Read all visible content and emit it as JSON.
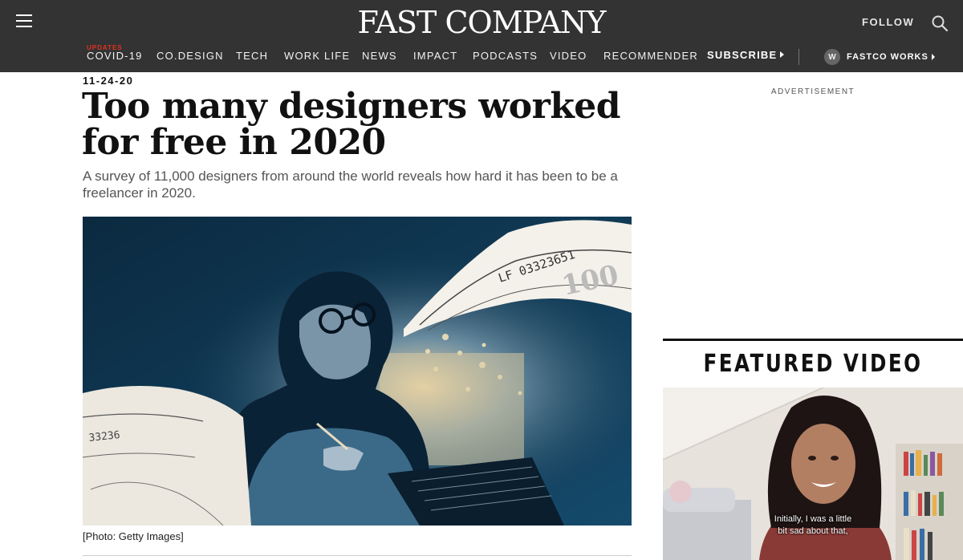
{
  "header": {
    "logo": "FAST COMPANY",
    "follow_label": "FOLLOW",
    "updates_label": "UPDATES",
    "nav": [
      {
        "label": "COVID-19"
      },
      {
        "label": "CO.DESIGN"
      },
      {
        "label": "TECH"
      },
      {
        "label": "WORK LIFE"
      },
      {
        "label": "NEWS"
      },
      {
        "label": "IMPACT"
      },
      {
        "label": "PODCASTS"
      },
      {
        "label": "VIDEO"
      },
      {
        "label": "RECOMMENDER"
      }
    ],
    "subscribe_label": "SUBSCRIBE",
    "fastco_works": {
      "badge": "W",
      "label": "FASTCO WORKS"
    }
  },
  "article": {
    "date": "11-24-20",
    "headline": "Too many designers worked for free in 2020",
    "dek": "A survey of 11,000 designers from around the world reveals how hard it has been to be a freelancer in 2020.",
    "caption": "[Photo: Getty Images]",
    "banknote_serial": "LF 03323651"
  },
  "sidebar": {
    "ad_label": "ADVERTISEMENT",
    "featured_video_title": "FEATURED VIDEO",
    "video_subtitle": "Initially, I was a little bit sad about that,"
  },
  "colors": {
    "header_bg": "#333333",
    "updates_red": "#e2311d",
    "hero_blue": "#0e3550"
  },
  "icons": [
    "hamburger-menu-icon",
    "search-icon",
    "play-arrow-icon"
  ]
}
